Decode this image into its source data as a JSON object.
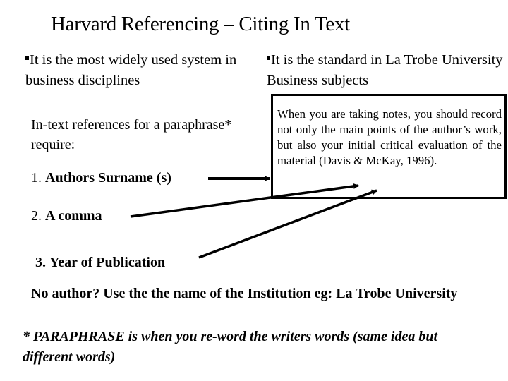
{
  "slide": {
    "title": "Harvard Referencing – Citing In Text",
    "bullets": [
      {
        "text": "It is the most widely used system in business disciplines"
      },
      {
        "text": "It is the standard in La Trobe University Business subjects"
      }
    ],
    "quote_box": {
      "text": "When you are taking notes, you should record not only the main points of the author’s work, but also your initial critical evaluation of the material (Davis & McKay, 1996)."
    },
    "intro": "In-text references for a paraphrase* require:",
    "requirements": [
      {
        "number": "1.",
        "label": "Authors Surname (s)"
      },
      {
        "number": "2.",
        "label": "A comma"
      },
      {
        "number": "3.",
        "label": "Year of Publication"
      }
    ],
    "no_author_note": "No author? Use the the name of the Institution eg: La Trobe University",
    "paraphrase_note": "* PARAPHRASE is when you re-word the writers words (same idea but different words)"
  }
}
